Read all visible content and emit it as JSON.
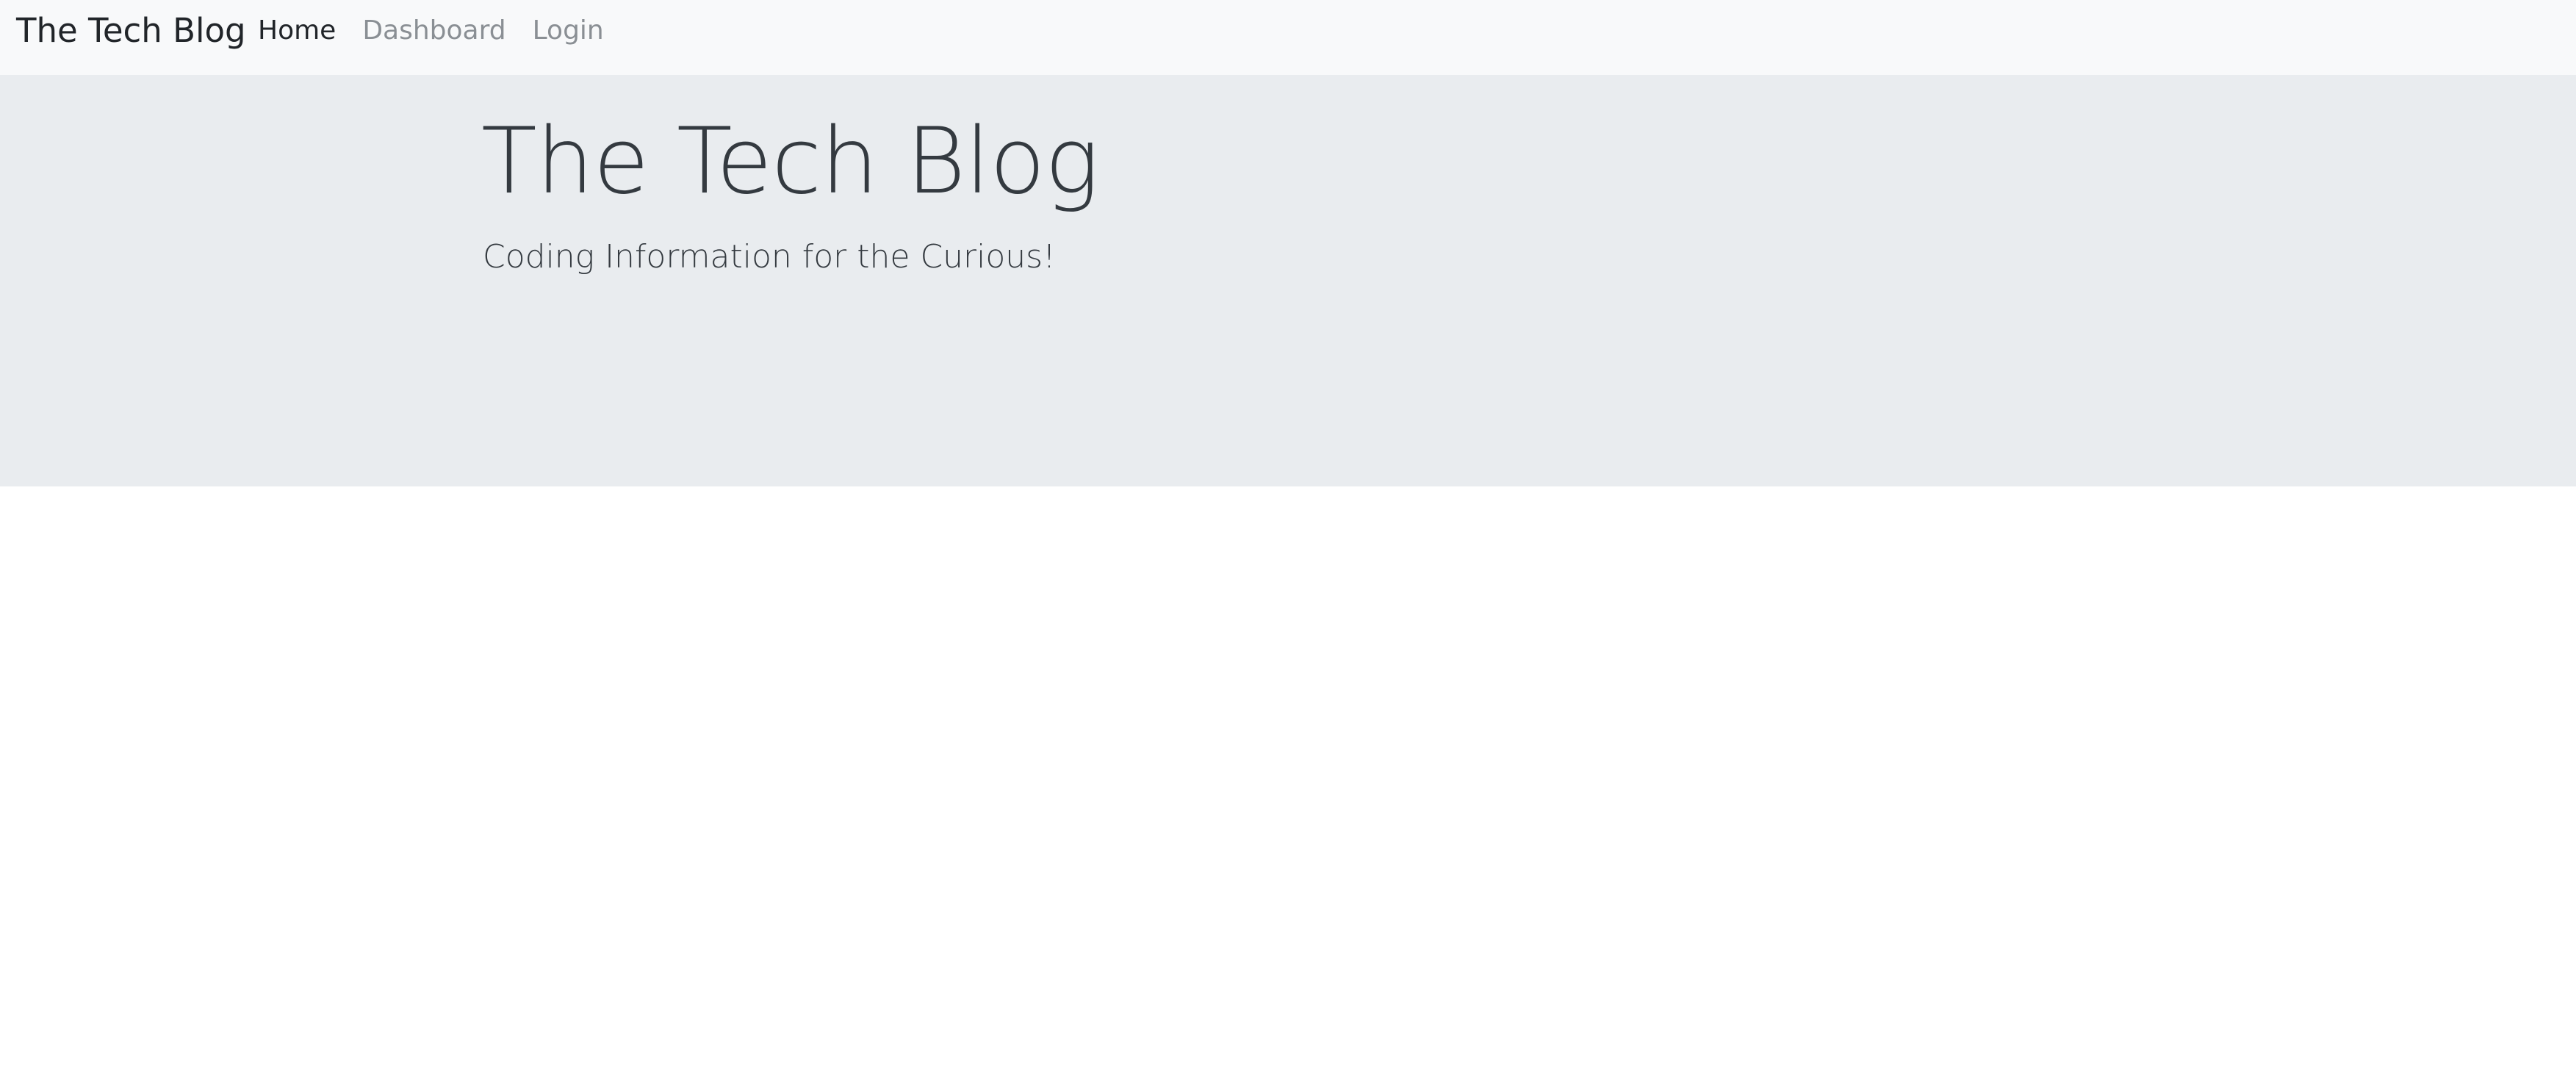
{
  "navbar": {
    "brand": "The Tech Blog",
    "links": [
      {
        "label": "Home",
        "active": true
      },
      {
        "label": "Dashboard",
        "active": false
      },
      {
        "label": "Login",
        "active": false
      }
    ]
  },
  "hero": {
    "title": "The Tech Blog",
    "subtitle": "Coding Information for the Curious!"
  },
  "colors": {
    "navbar_bg": "#f8f9fa",
    "hero_bg": "#e9ecef",
    "text_dark": "#343a40",
    "link_muted": "#8a8f94"
  }
}
